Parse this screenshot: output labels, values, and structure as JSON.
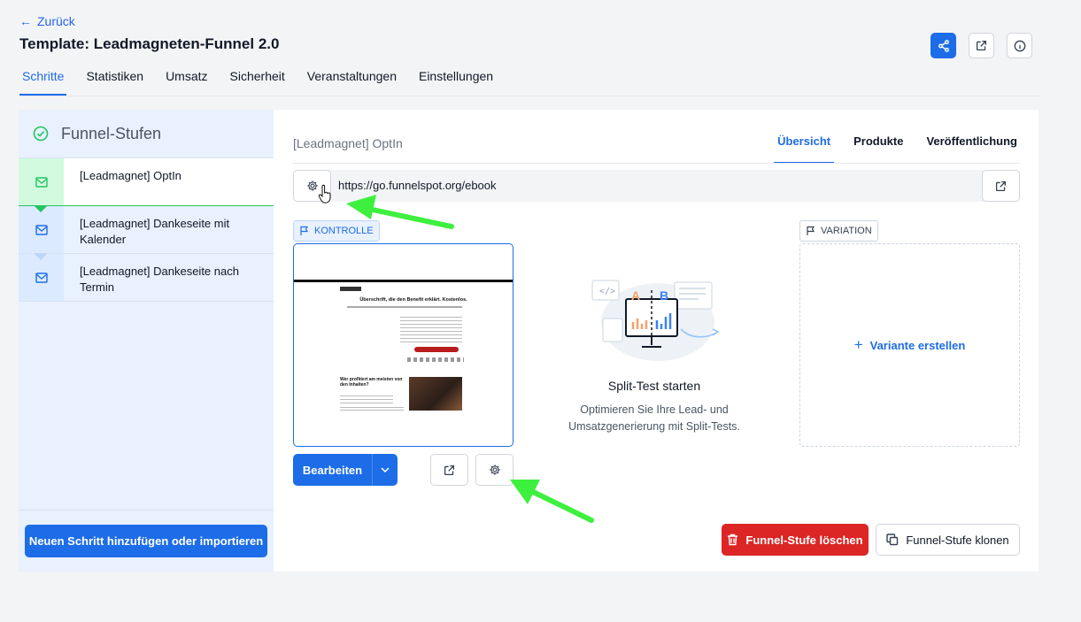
{
  "header": {
    "back_label": "Zurück",
    "title": "Template: Leadmagneten-Funnel 2.0"
  },
  "main_tabs": [
    "Schritte",
    "Statistiken",
    "Umsatz",
    "Sicherheit",
    "Veranstaltungen",
    "Einstellungen"
  ],
  "sidebar": {
    "title": "Funnel-Stufen",
    "steps": [
      {
        "label": "[Leadmagnet] OptIn"
      },
      {
        "label": "[Leadmagnet] Dankeseite mit Kalender"
      },
      {
        "label": "[Leadmagnet] Dankeseite nach Termin"
      }
    ],
    "add_button": "Neuen Schritt hinzufügen oder importieren"
  },
  "panel": {
    "title": "[Leadmagnet] OptIn",
    "sub_tabs": [
      "Übersicht",
      "Produkte",
      "Veröffentlichung"
    ],
    "url": "https://go.funnelspot.org/ebook",
    "control_badge": "KONTROLLE",
    "variation_badge": "VARIATION",
    "edit_label": "Bearbeiten",
    "split_title": "Split-Test starten",
    "split_desc": "Optimieren Sie Ihre Lead- und Umsatzgenerierung mit Split-Tests.",
    "create_variant": "Variante erstellen",
    "delete_label": "Funnel-Stufe löschen",
    "clone_label": "Funnel-Stufe klonen",
    "illu_letters": {
      "a": "A",
      "b": "B"
    }
  },
  "preview": {
    "headline": "Überschrift, die den Benefit erklärt. Kostenlos.",
    "section_title": "Wer profitiert am meisten von den Inhalten?"
  },
  "colors": {
    "primary": "#1d6ce8",
    "danger": "#dc2626",
    "success": "#22c55e",
    "annotation": "#3ef03e"
  }
}
